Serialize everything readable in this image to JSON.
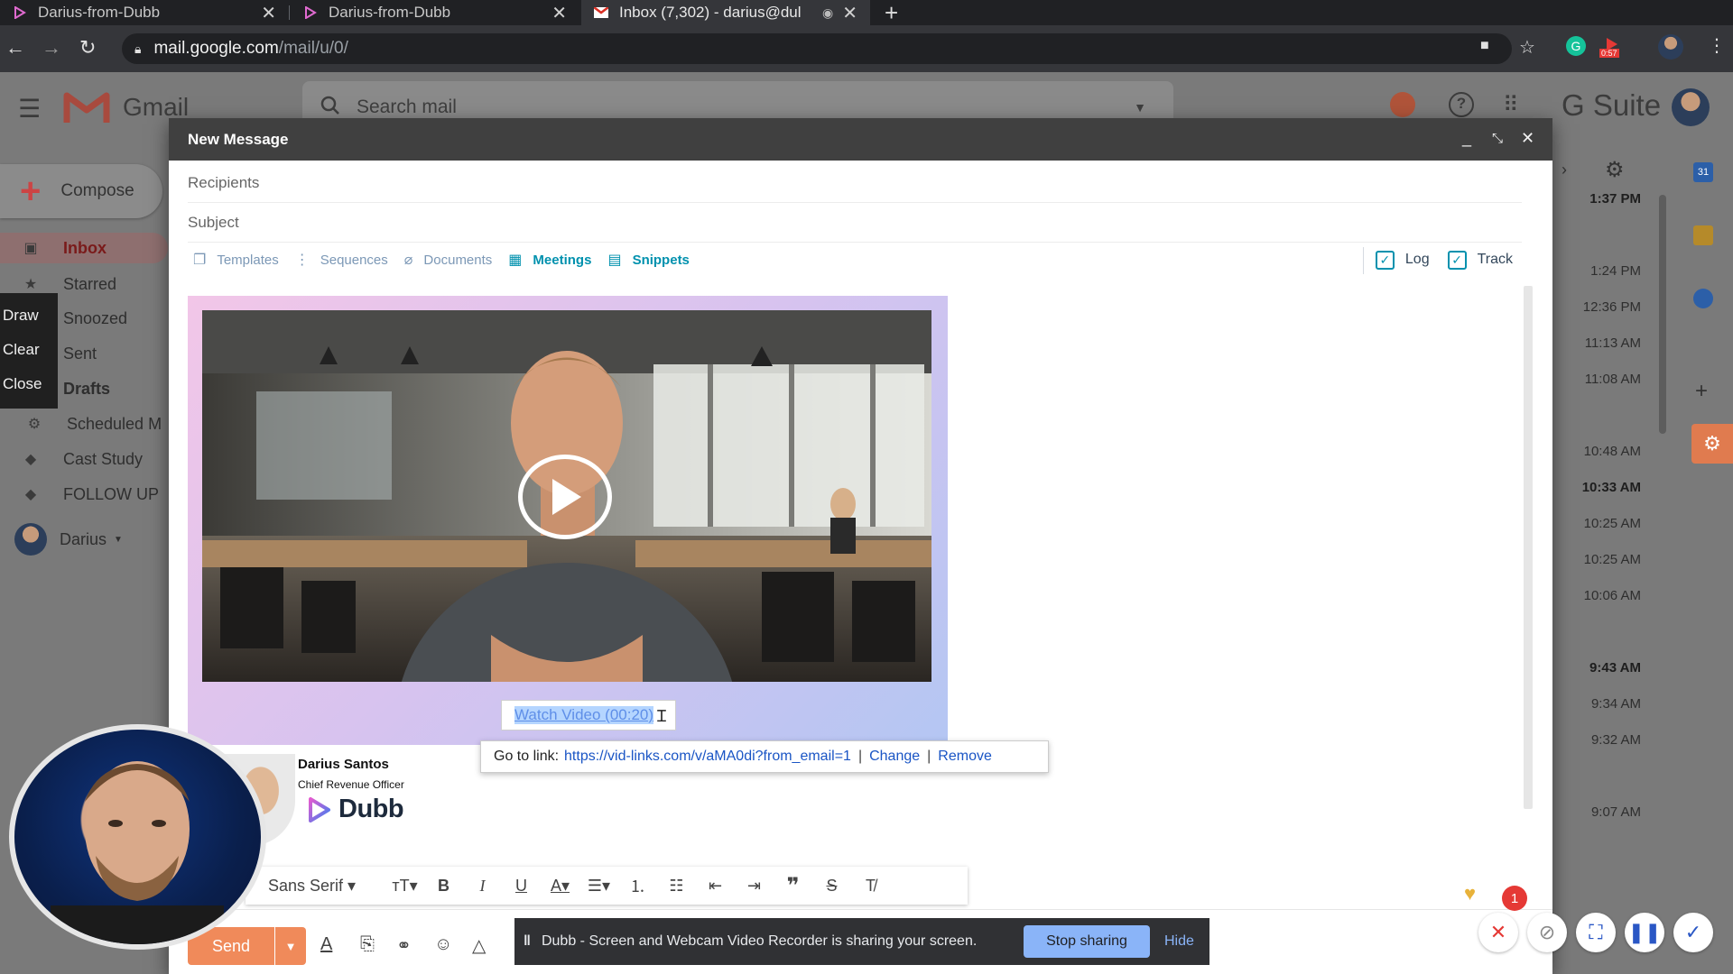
{
  "browser": {
    "tabs": [
      {
        "title": "Darius-from-Dubb",
        "icon": "dubb-favicon",
        "active": false
      },
      {
        "title": "Darius-from-Dubb",
        "icon": "dubb-favicon",
        "active": false
      },
      {
        "title": "Inbox (7,302) - darius@dul",
        "icon": "gmail-favicon",
        "active": true
      }
    ],
    "url_host": "mail.google.com",
    "url_path": "/mail/u/0/",
    "recording_timer": "0:57"
  },
  "gmail": {
    "app_name": "Gmail",
    "search_placeholder": "Search mail",
    "brand": "G Suite",
    "compose_label": "Compose",
    "nav": [
      {
        "label": "Inbox",
        "icon": "inbox-icon"
      },
      {
        "label": "Starred",
        "icon": "star-icon"
      },
      {
        "label": "Snoozed",
        "icon": "clock-icon"
      },
      {
        "label": "Sent",
        "icon": "send-icon"
      },
      {
        "label": "Drafts",
        "icon": "draft-icon"
      },
      {
        "label": "Scheduled M",
        "icon": "hubspot-icon"
      },
      {
        "label": "Cast Study",
        "icon": "label-icon"
      },
      {
        "label": "FOLLOW UP",
        "icon": "label-icon"
      }
    ],
    "user_name": "Darius",
    "times": [
      "1:37 PM",
      "1:24 PM",
      "12:36 PM",
      "11:13 AM",
      "11:08 AM",
      "10:48 AM",
      "10:33 AM",
      "10:25 AM",
      "10:25 AM",
      "10:06 AM",
      "9:43 AM",
      "9:34 AM",
      "9:32 AM",
      "9:07 AM"
    ]
  },
  "draw_menu": [
    "Draw",
    "Clear",
    "Close"
  ],
  "compose": {
    "title": "New Message",
    "recipients_placeholder": "Recipients",
    "subject_placeholder": "Subject",
    "hub_tools": [
      {
        "label": "Templates",
        "icon": "template-icon"
      },
      {
        "label": "Sequences",
        "icon": "sequence-icon"
      },
      {
        "label": "Documents",
        "icon": "document-icon"
      },
      {
        "label": "Meetings",
        "icon": "calendar-icon"
      },
      {
        "label": "Snippets",
        "icon": "snippet-icon"
      }
    ],
    "log_label": "Log",
    "track_label": "Track",
    "watch_video": "Watch Video (00:20)",
    "link_popup": {
      "prefix": "Go to link:",
      "url": "https://vid-links.com/v/aMA0di?from_email=1",
      "change": "Change",
      "remove": "Remove"
    },
    "signature": {
      "name": "Darius Santos",
      "title": "Chief Revenue Officer",
      "logo": "Dubb"
    },
    "font_name": "Sans Serif",
    "send_label": "Send"
  },
  "share_banner": {
    "text": "Dubb - Screen and Webcam Video Recorder is sharing your screen.",
    "stop": "Stop sharing",
    "hide": "Hide"
  },
  "notification_count": "1",
  "colors": {
    "hubspot_teal": "#0091ae",
    "hubspot_muted": "#7c98b6",
    "send_orange": "#f08a5a",
    "link_blue": "#1a55c5"
  }
}
